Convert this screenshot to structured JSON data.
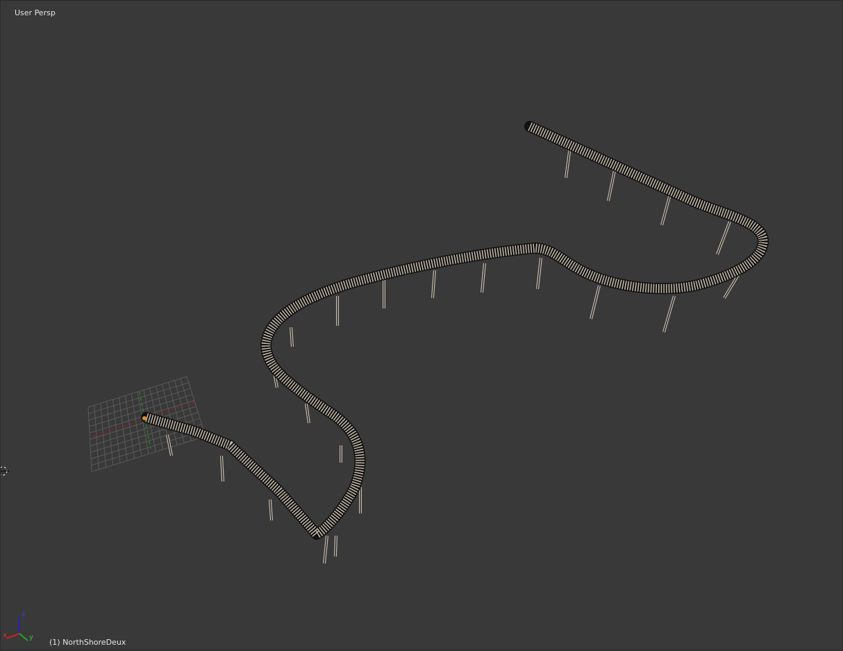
{
  "viewport": {
    "view_label": "User Persp",
    "object_label": "(1) NorthShoreDeux",
    "axes": {
      "x": "x",
      "y": "y",
      "z": "z"
    },
    "colors": {
      "background": "#393939",
      "track": "#c8bcae",
      "x_axis": "#b02020",
      "y_axis": "#20a020",
      "z_axis": "#2020c0"
    }
  }
}
